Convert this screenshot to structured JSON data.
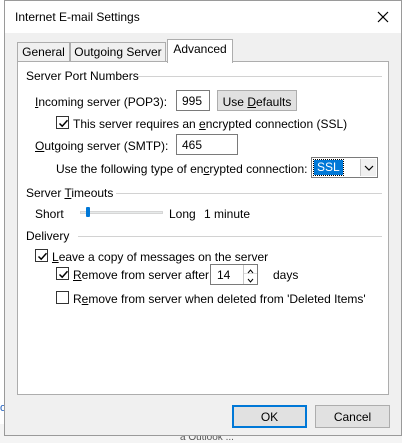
{
  "window": {
    "title": "Internet E-mail Settings"
  },
  "tabs": [
    {
      "label": "General"
    },
    {
      "label": "Outgoing Server"
    },
    {
      "label": "Advanced"
    }
  ],
  "server_ports": {
    "section_title": "Server Port Numbers",
    "incoming_label_pre": "I",
    "incoming_label_rest": "ncoming server (POP3):",
    "incoming_value": "995",
    "use_defaults_pre": "Use ",
    "use_defaults_ul": "D",
    "use_defaults_rest": "efaults",
    "ssl_required_pre": "This server requires an ",
    "ssl_required_ul": "e",
    "ssl_required_rest": "ncrypted connection (SSL)",
    "outgoing_label_pre": "",
    "outgoing_label_ul": "O",
    "outgoing_label_rest": "utgoing server (SMTP):",
    "outgoing_value": "465",
    "encryption_label_pre": "Use the following type of en",
    "encryption_label_ul": "c",
    "encryption_label_rest": "rypted connection:",
    "encryption_value": "SSL"
  },
  "timeouts": {
    "section_title_pre": "Server ",
    "section_title_ul": "T",
    "section_title_rest": "imeouts",
    "short_label": "Short",
    "long_label": "Long",
    "value_text": "1 minute",
    "slider_fraction": 0.1
  },
  "delivery": {
    "section_title": "Delivery",
    "leave_copy_pre": "",
    "leave_copy_ul": "L",
    "leave_copy_rest": "eave a copy of messages on the server",
    "remove_after_pre": "",
    "remove_after_ul": "R",
    "remove_after_rest": "emove from server after",
    "days_value": "14",
    "days_label": "days",
    "remove_deleted_pre": "R",
    "remove_deleted_ul": "e",
    "remove_deleted_rest": "move from server when deleted from 'Deleted Items'"
  },
  "footer": {
    "ok_label": "OK",
    "cancel_label": "Cancel"
  },
  "background": {
    "link_fragment": "o.",
    "text_fragment": "a Outlook ..."
  },
  "colors": {
    "accent": "#0078d7",
    "panel_bg": "#ffffff",
    "dialog_bg": "#f0f0f0"
  }
}
